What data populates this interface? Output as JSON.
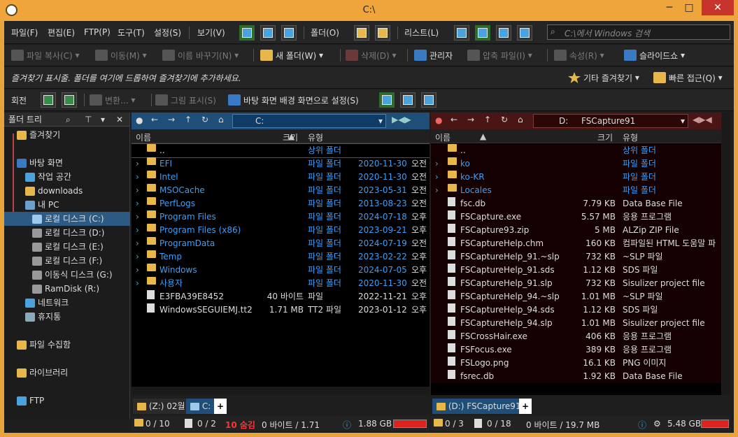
{
  "window": {
    "title": "C:\\",
    "min": "─",
    "max": "□",
    "close": "✕"
  },
  "menu": {
    "items": [
      "파일(F)",
      "편집(E)",
      "FTP(P)",
      "도구(T)",
      "설정(S)"
    ],
    "view": "보기(V)",
    "folder": "폴더(O)",
    "list": "리스트(L)",
    "search_placeholder": "C:\\에서 Windows 검색"
  },
  "toolbar": {
    "copy": "파일 복사(C)",
    "move": "이동(M)",
    "rename": "이름 바꾸기(N)",
    "new_folder": "새 폴더(W)",
    "delete": "삭제(D)",
    "admin": "관리자",
    "compress": "압축 파일(I)",
    "props": "속성(R)",
    "slideshow": "슬라이드쇼"
  },
  "favbar": {
    "text": "즐겨찾기 표시줄. 폴더를 여기에 드롭하여 즐겨찾기에 추가하세요.",
    "other": "기타 즐겨찾기",
    "quick": "빠른 접근(Q)"
  },
  "imgbar": {
    "rotate": "회전",
    "convert": "변환...",
    "show": "그림 표시(S)",
    "wallpaper": "바탕 화면 배경 화면으로 설정(S)"
  },
  "tree": {
    "header": "폴더 트리",
    "items": [
      {
        "label": "즐겨찾기"
      },
      {
        "label": "바탕 화면"
      },
      {
        "label": "작업 공간"
      },
      {
        "label": "downloads"
      },
      {
        "label": "내 PC"
      },
      {
        "label": "로컬 디스크 (C:)"
      },
      {
        "label": "로컬 디스크 (D:)"
      },
      {
        "label": "로컬 디스크 (E:)"
      },
      {
        "label": "로컬 디스크 (F:)"
      },
      {
        "label": "이동식 디스크 (G:)"
      },
      {
        "label": "RamDisk (R:)"
      },
      {
        "label": "네트워크"
      },
      {
        "label": "휴지통"
      },
      {
        "label": "파일 수집함"
      },
      {
        "label": "라이브러리"
      },
      {
        "label": "FTP"
      }
    ]
  },
  "left": {
    "path": [
      "C:"
    ],
    "cols": {
      "name": "이름",
      "size": "크기",
      "type": "유형"
    },
    "rows": [
      {
        "name": "..",
        "size": "",
        "type": "상위 폴더",
        "date": "",
        "time": ""
      },
      {
        "name": "EFI",
        "size": "",
        "type": "파일 폴더",
        "date": "2020-11-30",
        "time": "오전"
      },
      {
        "name": "Intel",
        "size": "",
        "type": "파일 폴더",
        "date": "2020-11-30",
        "time": "오전"
      },
      {
        "name": "MSOCache",
        "size": "",
        "type": "파일 폴더",
        "date": "2023-05-31",
        "time": "오전"
      },
      {
        "name": "PerfLogs",
        "size": "",
        "type": "파일 폴더",
        "date": "2013-08-23",
        "time": "오전"
      },
      {
        "name": "Program Files",
        "size": "",
        "type": "파일 폴더",
        "date": "2024-07-18",
        "time": "오후"
      },
      {
        "name": "Program Files (x86)",
        "size": "",
        "type": "파일 폴더",
        "date": "2023-09-21",
        "time": "오후"
      },
      {
        "name": "ProgramData",
        "size": "",
        "type": "파일 폴더",
        "date": "2024-07-19",
        "time": "오전"
      },
      {
        "name": "Temp",
        "size": "",
        "type": "파일 폴더",
        "date": "2023-02-22",
        "time": "오후"
      },
      {
        "name": "Windows",
        "size": "",
        "type": "파일 폴더",
        "date": "2024-07-05",
        "time": "오후"
      },
      {
        "name": "사용자",
        "size": "",
        "type": "파일 폴더",
        "date": "2020-11-30",
        "time": "오전"
      },
      {
        "name": "E3FBA39E8452",
        "size": "40 바이트",
        "type": "파일",
        "date": "2022-11-21",
        "time": "오후"
      },
      {
        "name": "WindowsSEGUIEMJ.tt2",
        "size": "1.71 MB",
        "type": "TT2 파일",
        "date": "2023-01-12",
        "time": "오후"
      }
    ],
    "tabs": [
      "(Z:) 02월",
      "C:",
      "+"
    ],
    "status": {
      "folders": "0 / 10",
      "files": "0 / 2",
      "hidden": "10 숨김",
      "bytes": "0 바이트 / 1.71",
      "free": "1.88 GB"
    }
  },
  "right": {
    "path": [
      "D:",
      "FSCapture91"
    ],
    "cols": {
      "name": "이름",
      "size": "크기",
      "type": "유형"
    },
    "rows": [
      {
        "name": "..",
        "size": "",
        "type": "상위 폴더"
      },
      {
        "name": "ko",
        "size": "",
        "type": "파일 폴더"
      },
      {
        "name": "ko-KR",
        "size": "",
        "type": "파일 폴더"
      },
      {
        "name": "Locales",
        "size": "",
        "type": "파일 폴더"
      },
      {
        "name": "fsc.db",
        "size": "7.79 KB",
        "type": "Data Base File"
      },
      {
        "name": "FSCapture.exe",
        "size": "5.57 MB",
        "type": "응용 프로그램"
      },
      {
        "name": "FSCapture93.zip",
        "size": "5 MB",
        "type": "ALZip ZIP File"
      },
      {
        "name": "FSCaptureHelp.chm",
        "size": "160 KB",
        "type": "컴파일된 HTML 도움말 파"
      },
      {
        "name": "FSCaptureHelp_91.~slp",
        "size": "732 KB",
        "type": "~SLP 파일"
      },
      {
        "name": "FSCaptureHelp_91.sds",
        "size": "1.12 KB",
        "type": "SDS 파일"
      },
      {
        "name": "FSCaptureHelp_91.slp",
        "size": "732 KB",
        "type": "Sisulizer project file"
      },
      {
        "name": "FSCaptureHelp_94.~slp",
        "size": "1.01 MB",
        "type": "~SLP 파일"
      },
      {
        "name": "FSCaptureHelp_94.sds",
        "size": "1.12 KB",
        "type": "SDS 파일"
      },
      {
        "name": "FSCaptureHelp_94.slp",
        "size": "1.01 MB",
        "type": "Sisulizer project file"
      },
      {
        "name": "FSCrossHair.exe",
        "size": "406 KB",
        "type": "응용 프로그램"
      },
      {
        "name": "FSFocus.exe",
        "size": "389 KB",
        "type": "응용 프로그램"
      },
      {
        "name": "FSLogo.png",
        "size": "16.1 KB",
        "type": "PNG 이미지"
      },
      {
        "name": "fsrec.db",
        "size": "1.92 KB",
        "type": "Data Base File"
      }
    ],
    "tabs": [
      "(D:) FSCapture91",
      "+"
    ],
    "status": {
      "folders": "0 / 3",
      "files": "0 / 18",
      "bytes": "0 바이트 / 19.7 MB",
      "free": "5.48 GB"
    }
  }
}
